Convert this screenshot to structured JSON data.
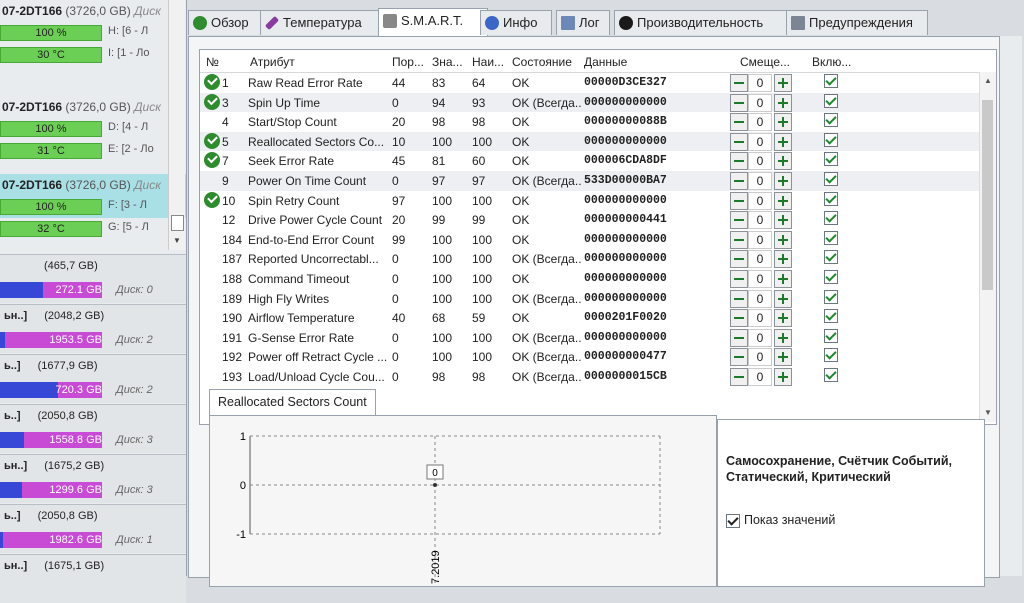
{
  "left": {
    "disks": [
      {
        "title": "07-2DT166",
        "size": "(3726,0 GB)",
        "tag": "Диск",
        "health": "100 %",
        "temp": "30 °C",
        "vol1": "H: [6 - Л",
        "vol2": "I: [1 - Ло"
      },
      {
        "title": "07-2DT166",
        "size": "(3726,0 GB)",
        "tag": "Диск",
        "health": "100 %",
        "temp": "31 °C",
        "vol1": "D: [4 - Л",
        "vol2": "E: [2 - Ло"
      },
      {
        "title": "07-2DT166",
        "size": "(3726,0 GB)",
        "tag": "Диск",
        "health": "100 %",
        "temp": "32 °C",
        "vol1": "F: [3 - Л",
        "vol2": "G: [5 - Л"
      }
    ],
    "volumes": [
      {
        "prefix": "",
        "cap": "(465,7 GB)",
        "free": "272.1 GB",
        "used_fraction": 0.42,
        "disk": "Диск: 0"
      },
      {
        "prefix": "ьн..]",
        "cap": "(2048,2 GB)",
        "free": "1953.5 GB",
        "used_fraction": 0.05,
        "disk": "Диск: 2"
      },
      {
        "prefix": "ь..]",
        "cap": "(1677,9 GB)",
        "free": "720.3 GB",
        "used_fraction": 0.57,
        "disk": "Диск: 2"
      },
      {
        "prefix": "ь..]",
        "cap": "(2050,8 GB)",
        "free": "1558.8 GB",
        "used_fraction": 0.24,
        "disk": "Диск: 3"
      },
      {
        "prefix": "ьн..]",
        "cap": "(1675,2 GB)",
        "free": "1299.6 GB",
        "used_fraction": 0.22,
        "disk": "Диск: 3"
      },
      {
        "prefix": "ь..]",
        "cap": "(2050,8 GB)",
        "free": "1982.6 GB",
        "used_fraction": 0.03,
        "disk": "Диск: 1"
      },
      {
        "prefix": "ьн..]",
        "cap": "(1675,1 GB)",
        "free": "",
        "used_fraction": 0,
        "disk": ""
      }
    ]
  },
  "tabs": [
    "Обзор",
    "Температура",
    "S.M.A.R.T.",
    "Инфо",
    "Лог",
    "Производительность",
    "Предупреждения"
  ],
  "grid": {
    "headers": [
      "№",
      "Атрибут",
      "Пор...",
      "Зна...",
      "Наи...",
      "Состояние",
      "Данные",
      "Смеще...",
      "Вклю..."
    ],
    "rows": [
      {
        "ok": true,
        "n": "1",
        "attr": "Raw Read Error Rate",
        "thr": "44",
        "val": "83",
        "worst": "64",
        "state": "OK",
        "data": "00000D3CE327",
        "off": "0"
      },
      {
        "ok": true,
        "n": "3",
        "attr": "Spin Up Time",
        "thr": "0",
        "val": "94",
        "worst": "93",
        "state": "OK (Всегда...",
        "data": "000000000000",
        "off": "0"
      },
      {
        "ok": false,
        "n": "4",
        "attr": "Start/Stop Count",
        "thr": "20",
        "val": "98",
        "worst": "98",
        "state": "OK",
        "data": "00000000088B",
        "off": "0"
      },
      {
        "ok": true,
        "n": "5",
        "attr": "Reallocated Sectors Co...",
        "thr": "10",
        "val": "100",
        "worst": "100",
        "state": "OK",
        "data": "000000000000",
        "off": "0"
      },
      {
        "ok": true,
        "n": "7",
        "attr": "Seek Error Rate",
        "thr": "45",
        "val": "81",
        "worst": "60",
        "state": "OK",
        "data": "000006CDA8DF",
        "off": "0"
      },
      {
        "ok": false,
        "n": "9",
        "attr": "Power On Time Count",
        "thr": "0",
        "val": "97",
        "worst": "97",
        "state": "OK (Всегда...",
        "data": "533D00000BA7",
        "off": "0"
      },
      {
        "ok": true,
        "n": "10",
        "attr": "Spin Retry Count",
        "thr": "97",
        "val": "100",
        "worst": "100",
        "state": "OK",
        "data": "000000000000",
        "off": "0"
      },
      {
        "ok": false,
        "n": "12",
        "attr": "Drive Power Cycle Count",
        "thr": "20",
        "val": "99",
        "worst": "99",
        "state": "OK",
        "data": "000000000441",
        "off": "0"
      },
      {
        "ok": false,
        "n": "184",
        "attr": "End-to-End Error Count",
        "thr": "99",
        "val": "100",
        "worst": "100",
        "state": "OK",
        "data": "000000000000",
        "off": "0"
      },
      {
        "ok": false,
        "n": "187",
        "attr": "Reported Uncorrectabl...",
        "thr": "0",
        "val": "100",
        "worst": "100",
        "state": "OK (Всегда...",
        "data": "000000000000",
        "off": "0"
      },
      {
        "ok": false,
        "n": "188",
        "attr": "Command Timeout",
        "thr": "0",
        "val": "100",
        "worst": "100",
        "state": "OK",
        "data": "000000000000",
        "off": "0"
      },
      {
        "ok": false,
        "n": "189",
        "attr": "High Fly Writes",
        "thr": "0",
        "val": "100",
        "worst": "100",
        "state": "OK (Всегда...",
        "data": "000000000000",
        "off": "0"
      },
      {
        "ok": false,
        "n": "190",
        "attr": "Airflow Temperature",
        "thr": "40",
        "val": "68",
        "worst": "59",
        "state": "OK",
        "data": "0000201F0020",
        "off": "0"
      },
      {
        "ok": false,
        "n": "191",
        "attr": "G-Sense Error Rate",
        "thr": "0",
        "val": "100",
        "worst": "100",
        "state": "OK (Всегда...",
        "data": "000000000000",
        "off": "0"
      },
      {
        "ok": false,
        "n": "192",
        "attr": "Power off Retract Cycle ...",
        "thr": "0",
        "val": "100",
        "worst": "100",
        "state": "OK (Всегда...",
        "data": "000000000477",
        "off": "0"
      },
      {
        "ok": false,
        "n": "193",
        "attr": "Load/Unload Cycle Cou...",
        "thr": "0",
        "val": "98",
        "worst": "98",
        "state": "OK (Всегда...",
        "data": "0000000015CB",
        "off": "0"
      }
    ]
  },
  "lower": {
    "tab": "Reallocated Sectors Count",
    "info": "Самосохранение, Счётчик Событий, Статический, Критический",
    "show_values": "Показ значений"
  },
  "chart_data": {
    "type": "line",
    "x": [
      "7.2019"
    ],
    "series": [
      {
        "values": [
          0
        ]
      }
    ],
    "ylim": [
      -1,
      1
    ],
    "yticks": [
      "1",
      "0",
      "-1"
    ],
    "point_label": "0"
  }
}
